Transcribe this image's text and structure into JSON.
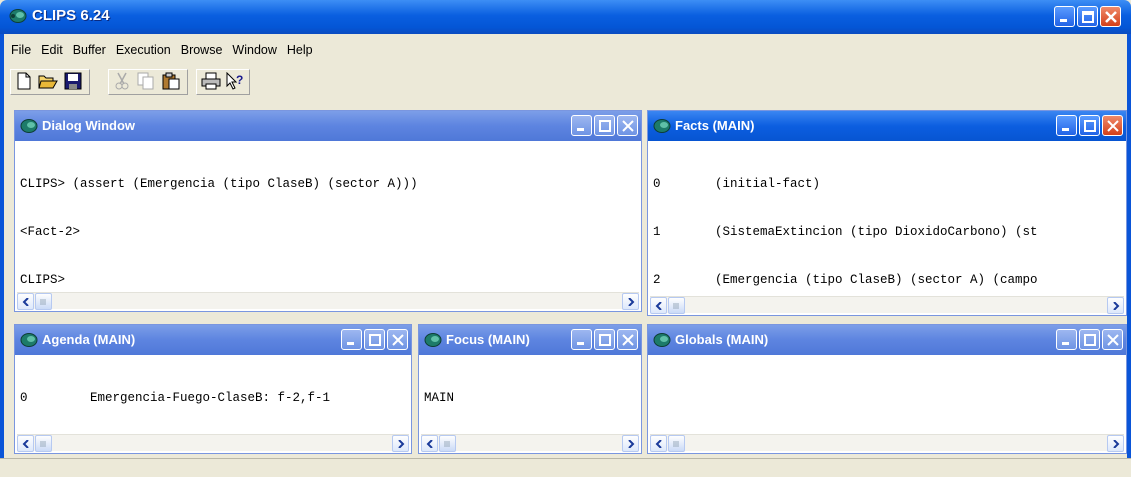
{
  "app": {
    "title": "CLIPS 6.24"
  },
  "menu": [
    "File",
    "Edit",
    "Buffer",
    "Execution",
    "Browse",
    "Window",
    "Help"
  ],
  "toolbar": {
    "buttons": [
      "new-icon",
      "open-icon",
      "save-icon",
      "cut-icon",
      "copy-icon",
      "paste-icon",
      "print-icon",
      "context-help-icon"
    ]
  },
  "dialog": {
    "title": "Dialog Window",
    "lines": [
      "CLIPS> (assert (Emergencia (tipo ClaseB) (sector A)))",
      "<Fact-2>",
      "CLIPS>"
    ]
  },
  "facts": {
    "title": "Facts (MAIN)",
    "rows": [
      {
        "index": "0",
        "text": "(initial-fact)"
      },
      {
        "index": "1",
        "text": "(SistemaExtincion (tipo DioxidoCarbono) (st"
      },
      {
        "index": "2",
        "text": "(Emergencia (tipo ClaseB) (sector A) (campo"
      }
    ]
  },
  "agenda": {
    "title": "Agenda (MAIN)",
    "rows": [
      {
        "salience": "0",
        "text": "Emergencia-Fuego-ClaseB: f-2,f-1"
      }
    ]
  },
  "focus": {
    "title": "Focus (MAIN)",
    "lines": [
      "MAIN"
    ]
  },
  "globals": {
    "title": "Globals (MAIN)"
  },
  "colors": {
    "titlebar": "#0a5fe0",
    "inactive_titlebar": "#7c9ee8",
    "close": "#d3401a",
    "face": "#ece9d8"
  }
}
